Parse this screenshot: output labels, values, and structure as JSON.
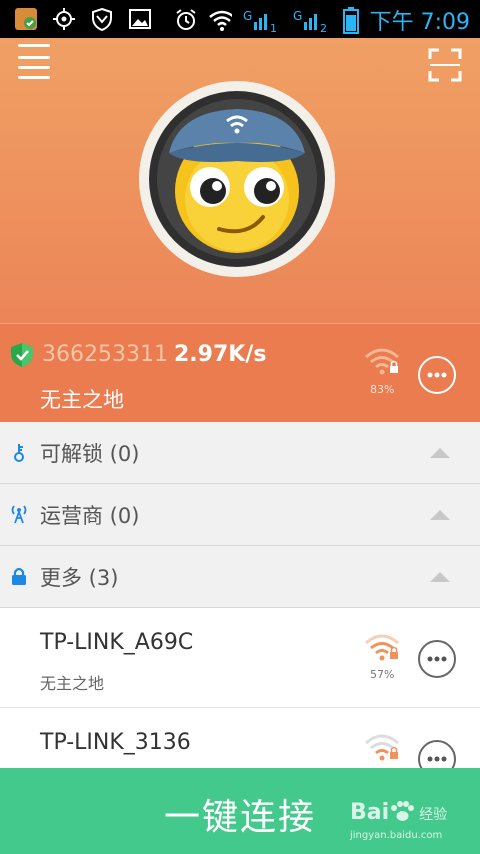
{
  "status_bar": {
    "time": "下午 7:09",
    "sim1_label": "1",
    "sim2_label": "2",
    "signal_type": "G",
    "icons": [
      "app-icon",
      "location-icon",
      "shield-icon",
      "gallery-icon",
      "alarm-icon",
      "wifi-icon",
      "signal-icon",
      "signal-icon",
      "battery-icon"
    ]
  },
  "header": {
    "menu_icon": "menu-icon",
    "scan_icon": "scan-icon",
    "has_notification_dot": true
  },
  "current_connection": {
    "id": "366253311",
    "speed": "2.97K/s",
    "ssid": "无主之地",
    "signal_percent": "83%"
  },
  "sections": [
    {
      "label": "可解锁 (0)",
      "icon": "key-icon"
    },
    {
      "label": "运营商 (0)",
      "icon": "antenna-icon"
    },
    {
      "label": "更多 (3)",
      "icon": "lock-icon"
    }
  ],
  "networks": [
    {
      "name": "TP-LINK_A69C",
      "subtitle": "无主之地",
      "signal_percent": "57%"
    },
    {
      "name": "TP-LINK_3136",
      "subtitle": "",
      "signal_percent": ""
    }
  ],
  "connect_button": {
    "label": "一键连接"
  },
  "watermark": {
    "brand": "Bai",
    "suffix": "经验",
    "url": "jingyan.baidu.com"
  },
  "colors": {
    "hero_top": "#f0a064",
    "hero_bottom": "#ec8558",
    "info_bar": "#ea7c50",
    "connect": "#43c98c",
    "status_text": "#29b6f6",
    "section_bg": "#f1f1f1"
  }
}
